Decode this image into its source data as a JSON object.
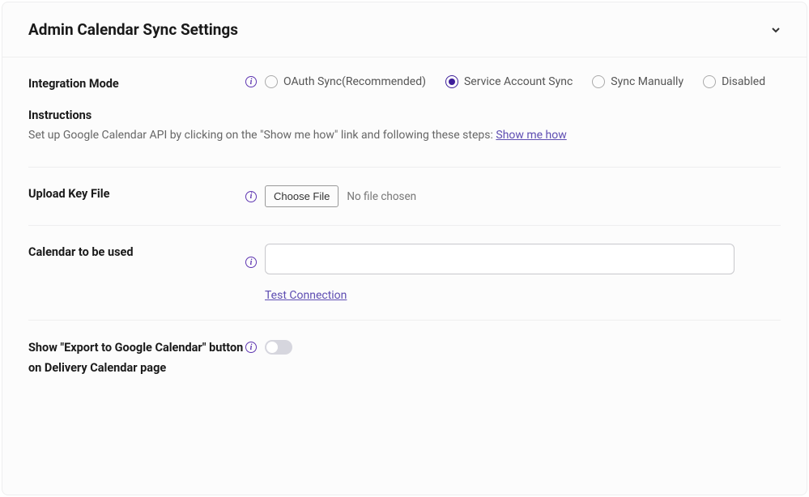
{
  "header": {
    "title": "Admin Calendar Sync Settings"
  },
  "integration_mode": {
    "label": "Integration Mode",
    "options": [
      {
        "label": "OAuth Sync(Recommended)",
        "selected": false
      },
      {
        "label": "Service Account Sync",
        "selected": true
      },
      {
        "label": "Sync Manually",
        "selected": false
      },
      {
        "label": "Disabled",
        "selected": false
      }
    ]
  },
  "instructions": {
    "title": "Instructions",
    "text": "Set up Google Calendar API by clicking on the \"Show me how\" link and following these steps: ",
    "link_text": "Show me how"
  },
  "upload": {
    "label": "Upload Key File",
    "button": "Choose File",
    "status": "No file chosen"
  },
  "calendar": {
    "label": "Calendar to be used",
    "value": "",
    "test_link": "Test Connection"
  },
  "export_toggle": {
    "label": "Show \"Export to Google Calendar\" button on Delivery Calendar page",
    "checked": false
  }
}
